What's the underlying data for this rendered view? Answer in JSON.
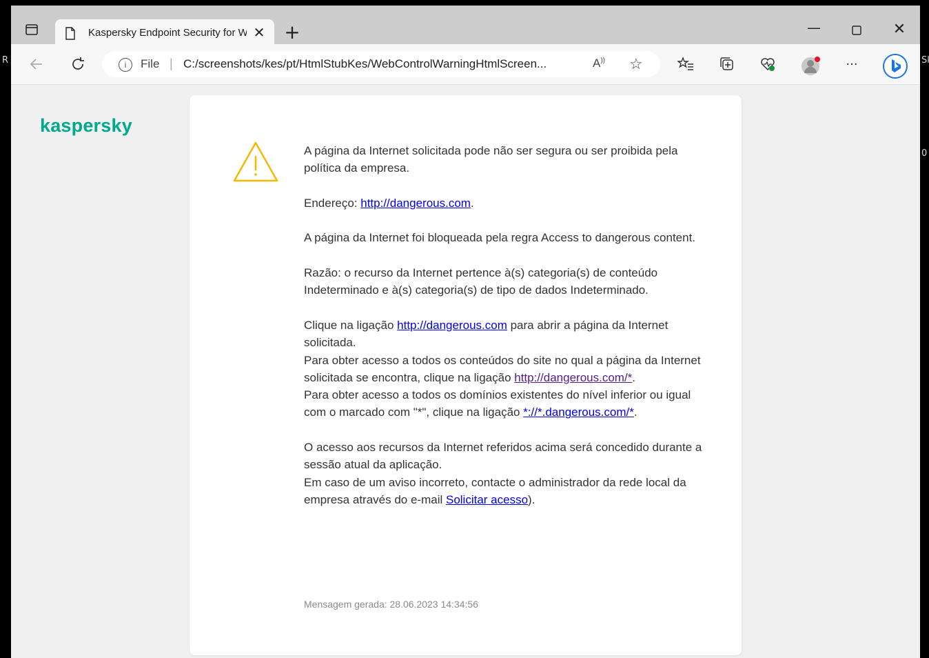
{
  "browser": {
    "tab_title": "Kaspersky Endpoint Security for W",
    "new_tab_label": "+",
    "address_scheme_label": "File",
    "address_url": "C:/screenshots/kes/pt/HtmlStubKes/WebControlWarningHtmlScreen...",
    "read_aloud_label": "A̅",
    "minimize_label": "—",
    "close_label": "✕",
    "tab_close_label": "✕"
  },
  "page": {
    "logo": "kaspersky",
    "intro": "A página da Internet solicitada pode não ser segura ou ser proibida pela política da empresa.",
    "address_prefix": "Endereço: ",
    "address_link": "http://dangerous.com",
    "address_suffix": ".",
    "blocked_rule": "A página da Internet foi bloqueada pela regra Access to dangerous content.",
    "reason": "Razão: o recurso da Internet pertence à(s) categoria(s) de conteúdo Indeterminado e à(s) categoria(s) de tipo de dados Indeterminado.",
    "click_prefix": "Clique na ligação ",
    "click_link": "http://dangerous.com",
    "click_suffix": " para abrir a página da Internet solicitada.",
    "site_access_text": "Para obter acesso a todos os conteúdos do site no qual a página da Internet solicitada se encontra, clique na ligação ",
    "site_access_link": "http://dangerous.com/*",
    "site_access_suffix": ".",
    "domain_access_text": "Para obter acesso a todos os domínios existentes do nível inferior ou igual com o marcado com \"*\", clique na ligação ",
    "domain_access_link": "*://*.dangerous.com/*",
    "domain_access_suffix": ".",
    "session_text": "O acesso aos recursos da Internet referidos acima será concedido durante a sessão atual da aplicação.",
    "contact_text": "Em caso de um aviso incorreto, contacte o administrador da rede local da empresa através do e-mail ",
    "contact_link": "Solicitar acesso",
    "contact_suffix": ").",
    "generated": "Mensagem gerada: 28.06.2023 14:34:56"
  },
  "colors": {
    "brand": "#00a88e",
    "warning_icon": "#f5b800",
    "link": "#0000ee",
    "visited_link": "#551a8b"
  },
  "icons": [
    "tab-actions-icon",
    "page-icon",
    "back-arrow-icon",
    "refresh-icon",
    "info-icon",
    "read-aloud-icon",
    "favorite-star-icon",
    "favorites-icon",
    "collections-icon",
    "browser-essentials-icon",
    "profile-avatar-icon",
    "more-icon",
    "bing-icon",
    "warning-icon"
  ]
}
